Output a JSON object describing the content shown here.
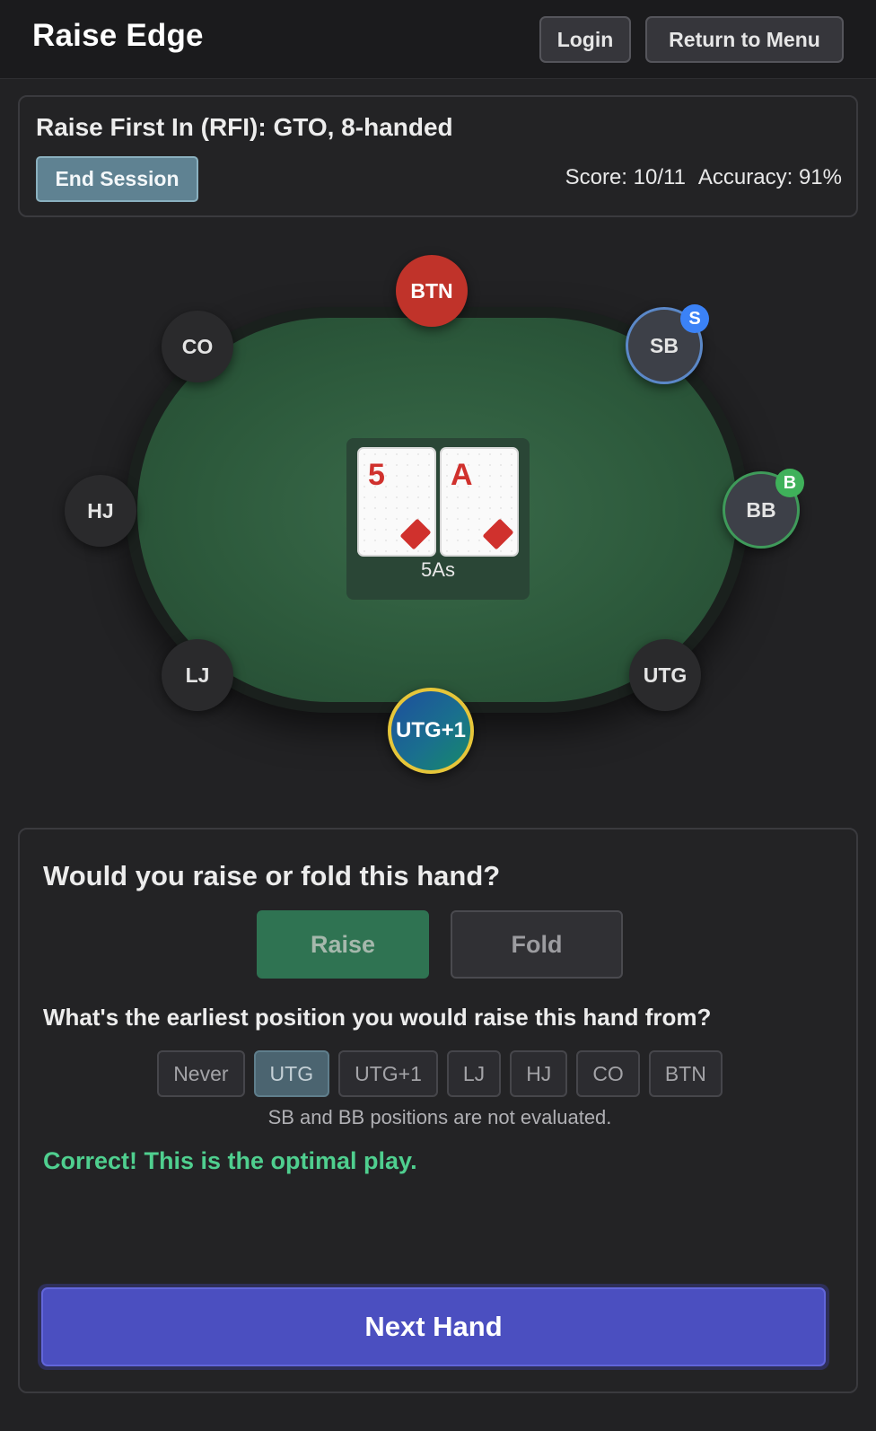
{
  "header": {
    "app_title": "Raise Edge",
    "login_label": "Login",
    "menu_label": "Return to Menu"
  },
  "session": {
    "title": "Raise First In (RFI): GTO, 8-handed",
    "end_label": "End Session",
    "score": "Score: 10/11",
    "accuracy": "Accuracy: 91%"
  },
  "table": {
    "seats": {
      "btn": "BTN",
      "sb": "SB",
      "bb": "BB",
      "co": "CO",
      "hj": "HJ",
      "lj": "LJ",
      "utg": "UTG",
      "hero": "UTG+1"
    },
    "badges": {
      "sb": "S",
      "bb": "B"
    },
    "hand": {
      "card1_rank": "5",
      "card1_suit": "diamond-icon",
      "card2_rank": "A",
      "card2_suit": "diamond-icon",
      "label": "5As"
    }
  },
  "question": {
    "q1": "Would you raise or fold this hand?",
    "raise_label": "Raise",
    "fold_label": "Fold",
    "q2": "What's the earliest position you would raise this hand from?",
    "positions": [
      "Never",
      "UTG",
      "UTG+1",
      "LJ",
      "HJ",
      "CO",
      "BTN"
    ],
    "selected_position": "UTG",
    "note": "SB and BB positions are not evaluated.",
    "feedback": "Correct! This is the optimal play.",
    "next_label": "Next Hand"
  },
  "colors": {
    "accent": "#4b4fc0",
    "felt": "#2d5a3c",
    "button_seat": "#c0332a",
    "hero_ring": "#e6c63a",
    "feedback_green": "#4fcf8f"
  }
}
